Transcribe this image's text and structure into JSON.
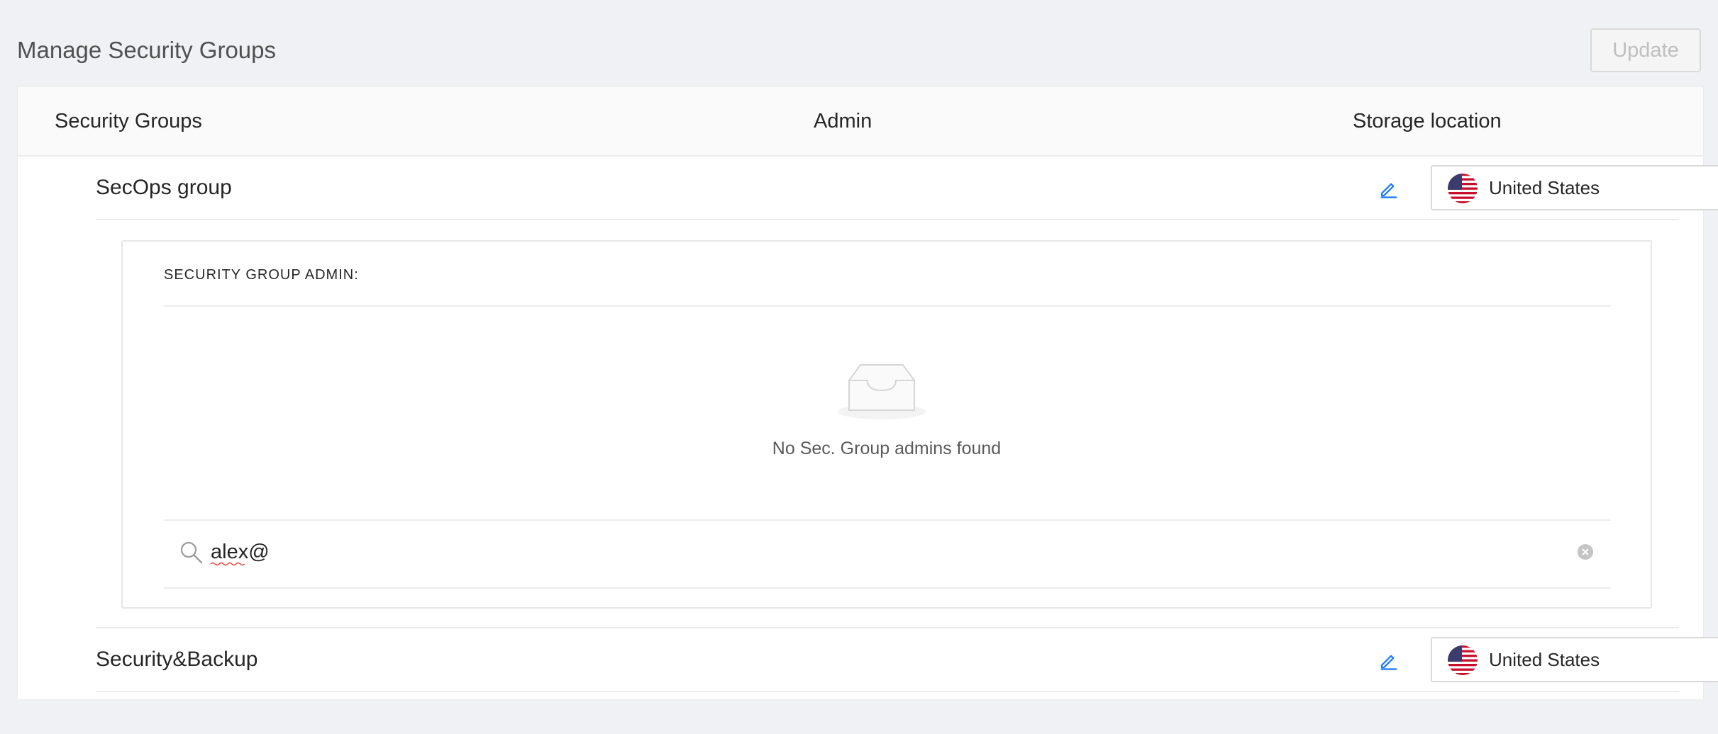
{
  "page": {
    "title": "Manage Security Groups"
  },
  "toolbar": {
    "update_label": "Update"
  },
  "table": {
    "columns": [
      "Security Groups",
      "Admin",
      "Storage location"
    ],
    "rows": [
      {
        "name": "SecOps group",
        "storage": "United States",
        "flag_icon": "us-flag-icon"
      },
      {
        "name": "Security&Backup",
        "storage": "United States",
        "flag_icon": "us-flag-icon"
      }
    ]
  },
  "admin_panel": {
    "label": "SECURITY GROUP ADMIN:",
    "empty_text": "No Sec. Group admins found",
    "search_value": "alex@"
  },
  "colors": {
    "accent": "#1677ff",
    "background": "#f0f1f5",
    "border": "#d9d9d9"
  }
}
